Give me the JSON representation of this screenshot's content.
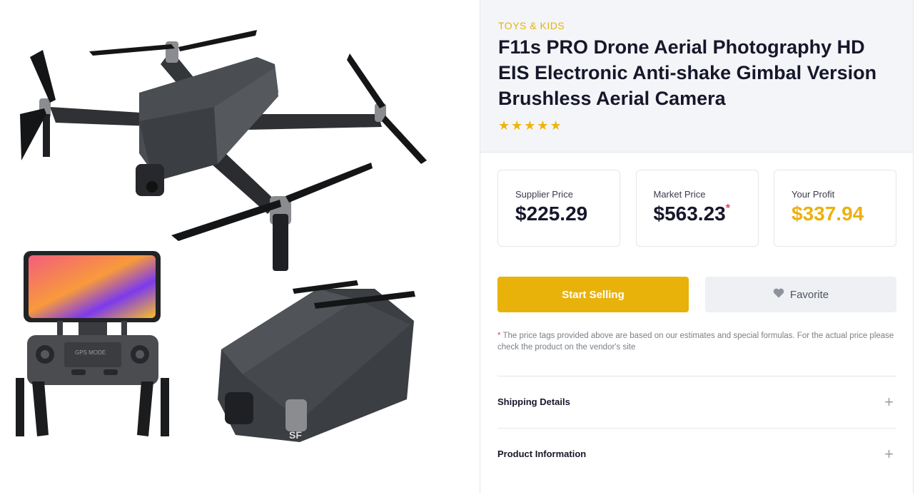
{
  "product": {
    "category": "TOYS & KIDS",
    "title": "F11s PRO Drone Aerial Photography HD EIS Electronic Anti-shake Gimbal Version Brushless Aerial Camera",
    "rating_stars": "★★★★★",
    "rating": 5
  },
  "images": {
    "phone_screen_colors": [
      "#f35d7b",
      "#f89a3c",
      "#7c3aed",
      "#fbbf24"
    ],
    "remote_text": "GPS MODE",
    "folded_text": "SF"
  },
  "prices": [
    {
      "label": "Supplier Price",
      "value": "$225.29"
    },
    {
      "label": "Market Price",
      "value": "$563.23",
      "asterisk": "*"
    },
    {
      "label": "Your Profit",
      "value": "$337.94"
    }
  ],
  "actions": {
    "primary_label": "Start Selling",
    "secondary_label": "Favorite",
    "secondary_icon": "heart-icon"
  },
  "disclaimer": {
    "asterisk": "*",
    "text": "The price tags provided above are based on our estimates and special formulas. For the actual price please check the product on the vendor's site"
  },
  "sections": [
    {
      "label": "Shipping Details",
      "icon": "plus-icon"
    },
    {
      "label": "Product Information",
      "icon": "plus-icon"
    }
  ],
  "colors": {
    "accent": "#e9b20b",
    "asterisk": "#e0445e"
  }
}
